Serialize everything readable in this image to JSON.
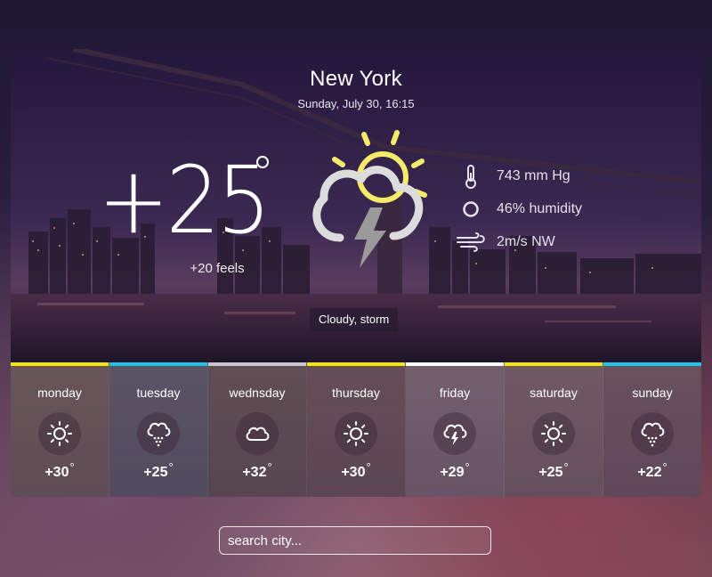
{
  "location": {
    "city": "New York",
    "datetime": "Sunday, July 30, 16:15"
  },
  "current": {
    "temperature": "+25",
    "feels": "+20 feels",
    "condition": "Cloudy, storm",
    "icon": "cloud-sun-storm-icon"
  },
  "details": [
    {
      "icon": "thermometer-icon",
      "text": "743 mm Hg"
    },
    {
      "icon": "humidity-icon",
      "text": "46% humidity"
    },
    {
      "icon": "wind-icon",
      "text": "2m/s NW"
    }
  ],
  "forecast": [
    {
      "day": "monday",
      "temp": "+30",
      "deg": "°",
      "icon": "sun-icon",
      "bar_color": "#f3e600",
      "bg": "#6e5a5b"
    },
    {
      "day": "tuesday",
      "temp": "+25",
      "deg": "°",
      "icon": "rain-cloud-icon",
      "bar_color": "#1fc6ea",
      "bg": "#5e5868"
    },
    {
      "day": "wednsday",
      "temp": "+32",
      "deg": "°",
      "icon": "cloud-icon",
      "bar_color": "#c9c6d0",
      "bg": "#645255"
    },
    {
      "day": "thursday",
      "temp": "+30",
      "deg": "°",
      "icon": "sun-icon",
      "bar_color": "#f3e600",
      "bg": "#6a5259"
    },
    {
      "day": "friday",
      "temp": "+29",
      "deg": "°",
      "icon": "storm-cloud-icon",
      "bar_color": "#ffffff",
      "bg": "#7a6470"
    },
    {
      "day": "saturday",
      "temp": "+25",
      "deg": "°",
      "icon": "sun-icon",
      "bar_color": "#f3e600",
      "bg": "#765e66"
    },
    {
      "day": "sunday",
      "temp": "+22",
      "deg": "°",
      "icon": "rain-cloud-icon",
      "bar_color": "#1fc6ea",
      "bg": "#6e5560"
    }
  ],
  "search": {
    "placeholder": "search city..."
  }
}
